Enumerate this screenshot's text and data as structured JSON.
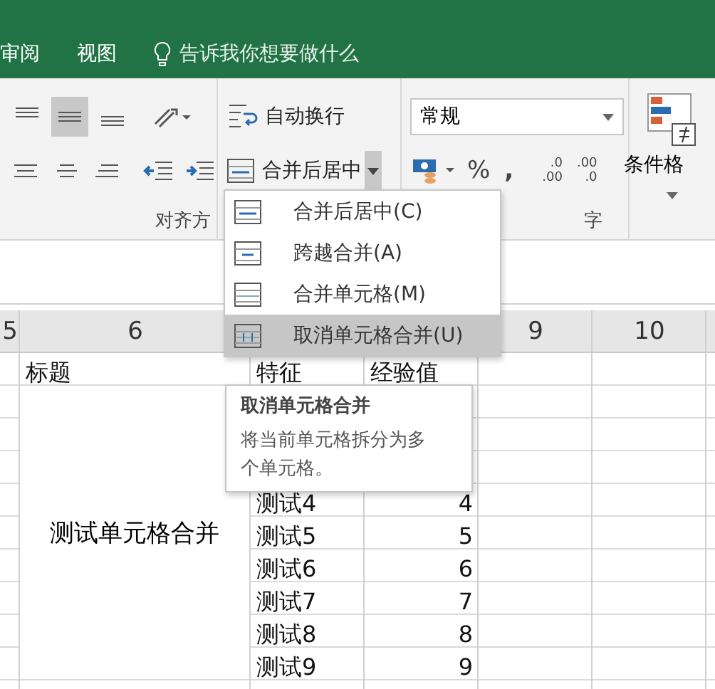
{
  "ribbon_tabs": [
    {
      "label": "审阅"
    },
    {
      "label": "视图"
    }
  ],
  "tell_me": "告诉我你想要做什么",
  "alignment": {
    "vertical": [
      {
        "selected": false
      },
      {
        "selected": true
      },
      {
        "selected": false
      }
    ],
    "wrap_text": "自动换行",
    "merge_center": "合并后居中",
    "group_label": "对齐方"
  },
  "number": {
    "format": "常规",
    "percent": "%",
    "comma": ",",
    "decimals": [
      {
        "top": ".0",
        "bottom": ".00"
      },
      {
        "top": ".00",
        "bottom": ".0"
      }
    ],
    "group_label": "字"
  },
  "styles": {
    "conditional_format": "条件格"
  },
  "merge_menu": {
    "items": [
      {
        "kind": "center",
        "label": "合并后居中(C)",
        "selected": false
      },
      {
        "kind": "across",
        "label": "跨越合并(A)",
        "selected": false
      },
      {
        "kind": "merge",
        "label": "合并单元格(M)",
        "selected": false
      },
      {
        "kind": "unmerge",
        "label": "取消单元格合并(U)",
        "selected": true
      }
    ]
  },
  "tooltip": {
    "title": "取消单元格合并",
    "body": "将当前单元格拆分为多个单元格。"
  },
  "sheet": {
    "columns": [
      {
        "label": "5"
      },
      {
        "label": "6"
      },
      {},
      {},
      {
        "label": "9"
      },
      {
        "label": "10"
      }
    ],
    "title": "标题",
    "header_feature": "特征",
    "header_value": "经验值",
    "merged": "测试单元格合并",
    "rows": [
      {},
      {},
      {},
      {
        "feature": "测试4",
        "value": "4"
      },
      {
        "feature": "测试5",
        "value": "5"
      },
      {
        "feature": "测试6",
        "value": "6"
      },
      {
        "feature": "测试7",
        "value": "7"
      },
      {
        "feature": "测试8",
        "value": "8"
      },
      {
        "feature": "测试9",
        "value": "9"
      }
    ]
  }
}
